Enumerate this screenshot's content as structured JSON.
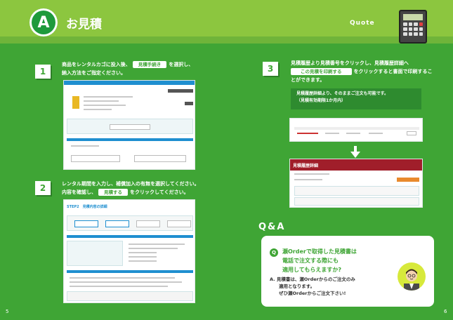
{
  "header": {
    "badge": "A",
    "title": "お見積",
    "subtitle": "Quote"
  },
  "steps": [
    {
      "num": "1",
      "line1_pre": "商品をレンタルカゴに投入後、",
      "button": "見積手続き",
      "line1_post": "を選択し、",
      "line2": "納入方法をご指定ください。"
    },
    {
      "num": "2",
      "line1": "レンタル期間を入力し、補償加入の有無を選択してください。",
      "line2_pre": "内容を確認し、",
      "button": "見積する",
      "line2_post": "をクリックしてください。"
    },
    {
      "num": "3",
      "line1": "見積履歴より見積番号をクリックし、見積履歴詳細へ",
      "button": "この見積を印刷する",
      "line2_post": "をクリックすると書面で印刷するこ",
      "line3": "とができます。"
    }
  ],
  "notice": {
    "line1": "見積履歴詳細より、そのままご注文も可能です。",
    "line2": "（見積有効期限1か月内）"
  },
  "screens": {
    "step2_heading": "STEP2　見積内容の詳細",
    "detail_heading": "見積履歴詳細"
  },
  "qa": {
    "title": "Q&A",
    "q_mark": "Q",
    "question": [
      "瀬Orderで取得した見積書は",
      "電話で注文する際にも",
      "適用してもらえますか?"
    ],
    "answer": [
      "A. 見積書は、瀬Orderからのご注文のみ",
      "適用となります。",
      "ぜひ瀬Orderからご注文下さい!"
    ]
  },
  "pages": {
    "left": "5",
    "right": "6"
  },
  "colors": {
    "background": "#3fa535",
    "band": "#8cc63f",
    "accent": "#1f8fd0"
  }
}
